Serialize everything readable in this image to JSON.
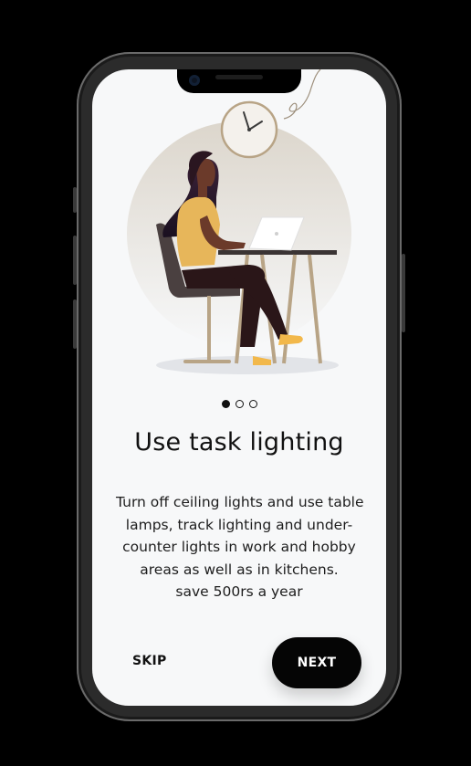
{
  "onboarding": {
    "title": "Use task lighting",
    "description_lines": [
      "Turn off ceiling lights and use table",
      "lamps, track lighting and under-",
      "counter lights in work and hobby",
      "areas as well as in kitchens.",
      "save 500rs a year"
    ],
    "page_indicator": {
      "total": 3,
      "current": 1
    },
    "illustration_icon": "woman-working-at-laptop-illustration",
    "skip_label": "SKIP",
    "next_label": "NEXT"
  },
  "colors": {
    "background": "#f7f8f9",
    "primary_button": "#050505",
    "text": "#111111",
    "accent_yellow": "#f2b84b"
  }
}
